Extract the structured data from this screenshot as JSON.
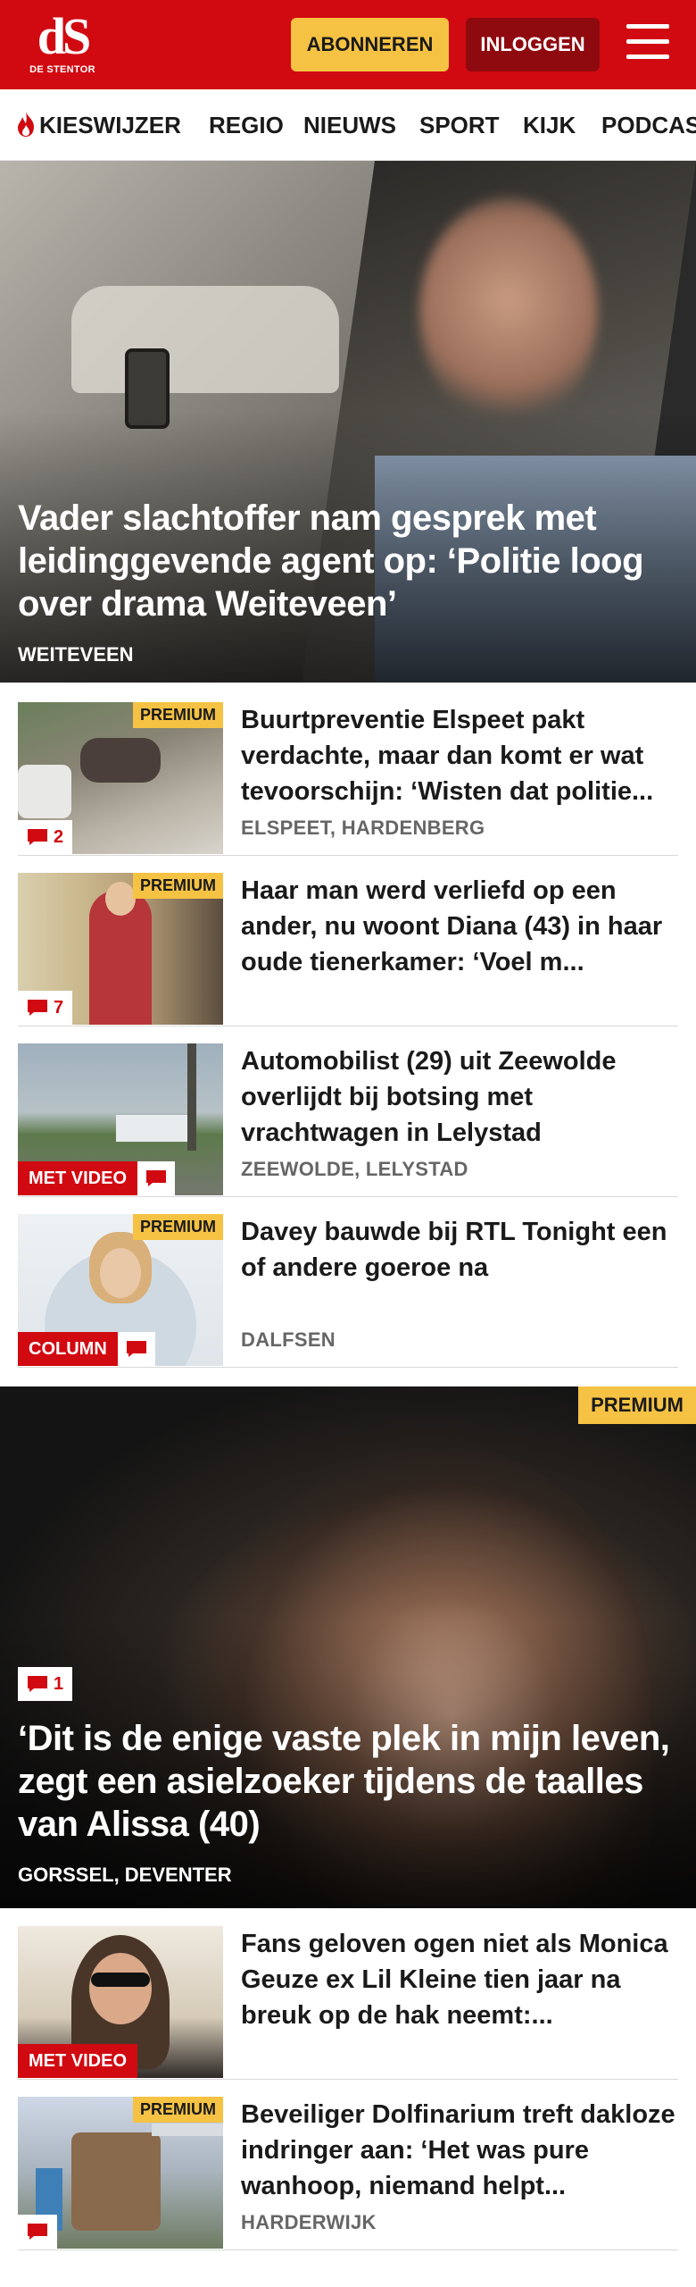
{
  "header": {
    "logo_mark": "dS",
    "logo_name": "DE STENTOR",
    "subscribe_label": "ABONNEREN",
    "login_label": "INLOGGEN",
    "menu_icon": "hamburger-icon",
    "brand_color": "#d10a11",
    "subscribe_color": "#f5c244"
  },
  "nav": {
    "items": [
      {
        "label": "KIESWIJZER",
        "icon": "flame-icon"
      },
      {
        "label": "REGIO"
      },
      {
        "label": "NIEUWS"
      },
      {
        "label": "SPORT"
      },
      {
        "label": "KIJK"
      },
      {
        "label": "PODCAS"
      }
    ]
  },
  "hero": {
    "title": "Vader slachtoffer nam gesprek met leidinggevende agent op: ‘Politie loog over drama Weiteveen’",
    "location": "WEITEVEEN"
  },
  "articles": [
    {
      "title": "Buurtpreventie Elspeet pakt verdachte, maar dan komt er wat tevoorschijn: ‘Wisten dat politie...",
      "location": "ELSPEET, HARDENBERG",
      "premium": "PREMIUM",
      "comments": "2"
    },
    {
      "title": "Haar man werd verliefd op een ander, nu woont Diana (43) in haar oude tienerkamer: ‘Voel m...",
      "location": "",
      "premium": "PREMIUM",
      "comments": "7"
    },
    {
      "title": "Automobilist (29) uit Zeewolde overlijdt bij botsing met vrachtwagen in Lelystad",
      "location": "ZEEWOLDE, LELYSTAD",
      "tag": "MET VIDEO"
    },
    {
      "title": "Davey bauwde bij RTL Tonight een of andere goeroe na",
      "location": "DALFSEN",
      "premium": "PREMIUM",
      "tag": "COLUMN"
    }
  ],
  "feature": {
    "premium": "PREMIUM",
    "comments": "1",
    "title": "‘Dit is de enige vaste plek in mijn leven, zegt een asielzoeker tijdens de taalles van Alissa (40)",
    "location": "GORSSEL, DEVENTER"
  },
  "articles2": [
    {
      "title": "Fans geloven ogen niet als Monica Geuze ex Lil Kleine tien jaar na breuk op de hak neemt:...",
      "location": "",
      "tag": "MET VIDEO"
    },
    {
      "title": "Beveiliger Dolfinarium treft dakloze indringer aan: ‘Het was pure wanhoop, niemand helpt...",
      "location": "HARDERWIJK",
      "premium": "PREMIUM"
    }
  ]
}
